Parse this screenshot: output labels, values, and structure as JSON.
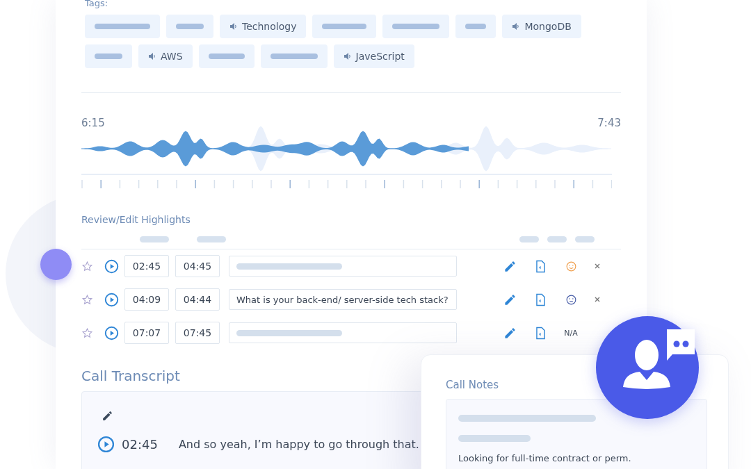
{
  "tags_label": "Tags:",
  "tags": [
    {
      "kind": "placeholder"
    },
    {
      "kind": "placeholder"
    },
    {
      "kind": "tag",
      "label": "Technology"
    },
    {
      "kind": "placeholder"
    },
    {
      "kind": "placeholder"
    },
    {
      "kind": "placeholder"
    },
    {
      "kind": "tag",
      "label": "MongoDB"
    },
    {
      "kind": "placeholder"
    },
    {
      "kind": "tag",
      "label": "AWS"
    },
    {
      "kind": "placeholder"
    },
    {
      "kind": "placeholder"
    },
    {
      "kind": "tag",
      "label": "JaveScript"
    }
  ],
  "player": {
    "start": "6:15",
    "end": "7:43",
    "level": 0.73
  },
  "highlights": {
    "title": "Review/Edit Highlights",
    "rows": [
      {
        "start": "02:45",
        "end": "04:45",
        "kind": "positive",
        "removable": true
      },
      {
        "start": "04:09",
        "end": "04:44",
        "text": "What is your back-end/ server-side tech stack?",
        "kind": "neutral",
        "removable": true
      },
      {
        "start": "07:07",
        "end": "07:45",
        "kind": "na",
        "sentiment_label": "N/A",
        "removable": false
      }
    ]
  },
  "transcript": {
    "title": "Call Transcript",
    "lines": [
      {
        "time": "02:45",
        "text": "And so yeah, I’m happy to go through that."
      }
    ]
  },
  "notes": {
    "title": "Call Notes",
    "text": "Looking for full-time contract or perm."
  }
}
